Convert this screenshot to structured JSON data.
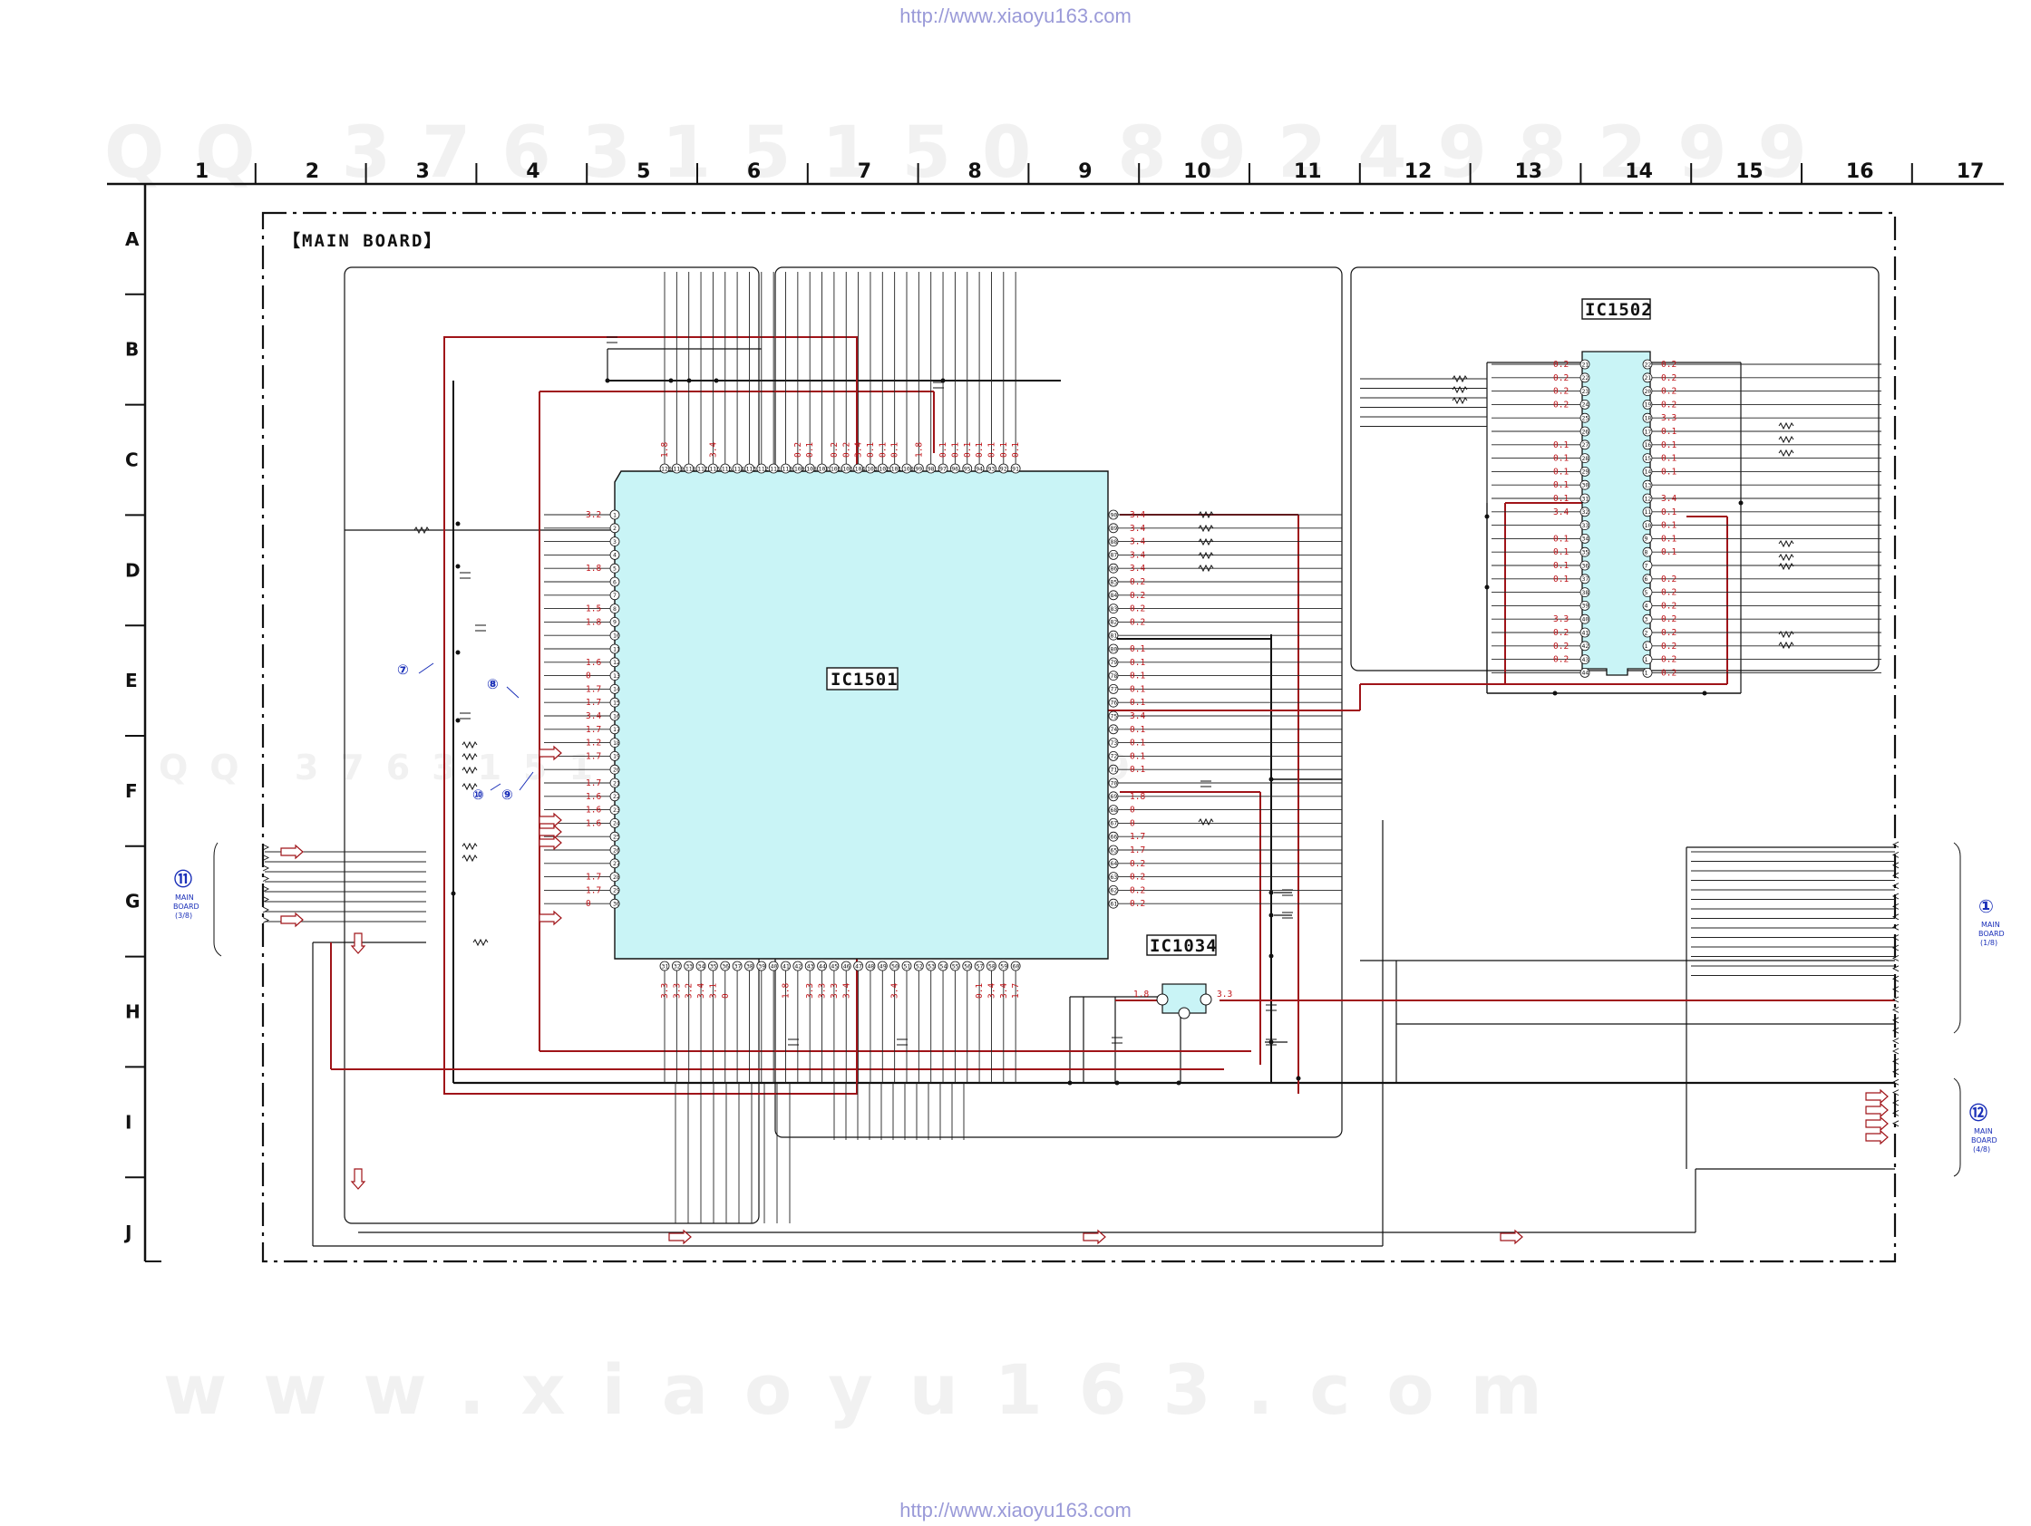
{
  "header": {
    "url": "http://www.xiaoyu163.com"
  },
  "footer": {
    "url": "http://www.xiaoyu163.com"
  },
  "watermarks": {
    "top_digits": "QQ 376315150  892498299",
    "mid_digits": "QQ 376315150  892498299",
    "bottom_site": "www.xiaoyu163.com"
  },
  "grid": {
    "columns": [
      "1",
      "2",
      "3",
      "4",
      "5",
      "6",
      "7",
      "8",
      "9",
      "10",
      "11",
      "12",
      "13",
      "14",
      "15",
      "16",
      "17"
    ],
    "rows": [
      "A",
      "B",
      "C",
      "D",
      "E",
      "F",
      "G",
      "H",
      "I",
      "J"
    ]
  },
  "board": {
    "title": "【MAIN BOARD】"
  },
  "ics": {
    "ic1501": "IC1501",
    "ic1502": "IC1502",
    "ic1034": "IC1034"
  },
  "connectors": {
    "left": {
      "number": "⑪",
      "line1": "MAIN",
      "line2": "BOARD",
      "line3": "(3/8)"
    },
    "right_top": {
      "number": "①",
      "line1": "MAIN",
      "line2": "BOARD",
      "line3": "(1/8)"
    },
    "right_bottom": {
      "number": "⑫",
      "line1": "MAIN",
      "line2": "BOARD",
      "line3": "(4/8)"
    }
  },
  "callouts": [
    "⑦",
    "⑧",
    "⑩",
    "⑨"
  ],
  "ic1501_left_voltages": [
    "3.2",
    "",
    "",
    "",
    "1.8",
    "",
    "",
    "1.5",
    "1.8",
    "",
    "",
    "1.6",
    "0",
    "1.7",
    "1.7",
    "3.4",
    "1.7",
    "1.2",
    "1.7",
    "",
    "1.7",
    "1.6",
    "1.6",
    "1.6",
    "",
    "",
    "",
    "1.7",
    "1.7",
    "0"
  ],
  "ic1501_right_voltages": [
    "3.4",
    "3.4",
    "3.4",
    "3.4",
    "3.4",
    "0.2",
    "0.2",
    "0.2",
    "0.2",
    "",
    "0.1",
    "0.1",
    "0.1",
    "0.1",
    "0.1",
    "3.4",
    "0.1",
    "0.1",
    "0.1",
    "0.1",
    "",
    "1.8",
    "0",
    "0",
    "1.7",
    "1.7",
    "0.2",
    "0.2",
    "0.2",
    "0.2"
  ],
  "ic1501_top_voltages": [
    "1.8",
    "",
    "",
    "",
    "3.4",
    "",
    "",
    "",
    "",
    "",
    "",
    "0.2",
    "0.1",
    "",
    "0.2",
    "0.2",
    "3.4",
    "0.1",
    "0.1",
    "0.1",
    "",
    "1.8",
    "",
    "0.1",
    "0.1",
    "0.1",
    "0.1",
    "0.1",
    "0.1",
    "0.1"
  ],
  "ic1501_bottom_voltages": [
    "3.3",
    "3.3",
    "3.2",
    "3.4",
    "3.1",
    "0",
    "",
    "",
    "",
    "",
    "1.8",
    "",
    "3.3",
    "3.3",
    "3.3",
    "3.4",
    "",
    "",
    "",
    "3.4",
    "",
    "",
    "",
    "",
    "",
    "",
    "0.1",
    "3.4",
    "3.4",
    "1.7"
  ],
  "ic1502_left_voltages": [
    "0.2",
    "0.2",
    "0.2",
    "0.2",
    "",
    "",
    "0.1",
    "0.1",
    "0.1",
    "0.1",
    "0.1",
    "3.4",
    "",
    "0.1",
    "0.1",
    "0.1",
    "0.1",
    "",
    "",
    "3.3",
    "0.2",
    "0.2",
    "0.2",
    ""
  ],
  "ic1502_right_voltages": [
    "0.2",
    "0.2",
    "0.2",
    "0.2",
    "3.3",
    "0.1",
    "0.1",
    "0.1",
    "0.1",
    "",
    "3.4",
    "0.1",
    "0.1",
    "0.1",
    "0.1",
    "",
    "0.2",
    "0.2",
    "0.2",
    "0.2",
    "0.2",
    "0.2",
    "0.2",
    "0.2"
  ],
  "ic1034_voltages": {
    "in": "1.8",
    "out": "3.3"
  }
}
